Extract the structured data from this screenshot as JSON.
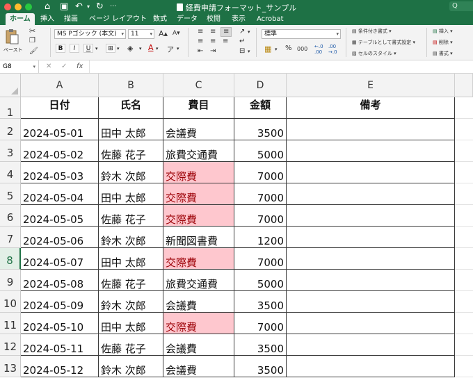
{
  "window": {
    "title": "経費申請フォーマット_サンプル",
    "search_placeholder": "Q"
  },
  "tabs": [
    "ホーム",
    "挿入",
    "描画",
    "ページ レイアウト",
    "数式",
    "データ",
    "校閲",
    "表示",
    "Acrobat"
  ],
  "ribbon": {
    "paste_label": "ペースト",
    "font_name": "MS Pゴシック (本文)",
    "font_size": "11",
    "grow_font": "A",
    "shrink_font": "A",
    "bold": "B",
    "italic": "I",
    "underline": "U",
    "font_color_letter": "A",
    "number_format": "標準",
    "percent": "%",
    "comma": "000",
    "conditional_format": "条件付き書式",
    "format_as_table": "テーブルとして書式設定",
    "cell_styles": "セルのスタイル",
    "insert": "挿入",
    "delete": "削除",
    "format": "書式"
  },
  "formula_bar": {
    "name_box": "G8",
    "fx": "fx",
    "cancel": "✕",
    "enter": "✓"
  },
  "sheet": {
    "columns": [
      "A",
      "B",
      "C",
      "D",
      "E"
    ],
    "rows": [
      "1",
      "2",
      "3",
      "4",
      "5",
      "6",
      "7",
      "8",
      "9",
      "10",
      "11",
      "12",
      "13"
    ],
    "selected_row": "8",
    "headers": [
      "日付",
      "氏名",
      "費目",
      "金額",
      "備考"
    ],
    "data": [
      {
        "date": "2024-05-01",
        "name": "田中 太郎",
        "category": "会議費",
        "amount": "3500",
        "note": "",
        "highlight": false
      },
      {
        "date": "2024-05-02",
        "name": "佐藤 花子",
        "category": "旅費交通費",
        "amount": "5000",
        "note": "",
        "highlight": false
      },
      {
        "date": "2024-05-03",
        "name": "鈴木 次郎",
        "category": "交際費",
        "amount": "7000",
        "note": "",
        "highlight": true
      },
      {
        "date": "2024-05-04",
        "name": "田中 太郎",
        "category": "交際費",
        "amount": "7000",
        "note": "",
        "highlight": true
      },
      {
        "date": "2024-05-05",
        "name": "佐藤 花子",
        "category": "交際費",
        "amount": "7000",
        "note": "",
        "highlight": true
      },
      {
        "date": "2024-05-06",
        "name": "鈴木 次郎",
        "category": "新聞図書費",
        "amount": "1200",
        "note": "",
        "highlight": false
      },
      {
        "date": "2024-05-07",
        "name": "田中 太郎",
        "category": "交際費",
        "amount": "7000",
        "note": "",
        "highlight": true
      },
      {
        "date": "2024-05-08",
        "name": "佐藤 花子",
        "category": "旅費交通費",
        "amount": "5000",
        "note": "",
        "highlight": false
      },
      {
        "date": "2024-05-09",
        "name": "鈴木 次郎",
        "category": "会議費",
        "amount": "3500",
        "note": "",
        "highlight": false
      },
      {
        "date": "2024-05-10",
        "name": "田中 太郎",
        "category": "交際費",
        "amount": "7000",
        "note": "",
        "highlight": true
      },
      {
        "date": "2024-05-11",
        "name": "佐藤 花子",
        "category": "会議費",
        "amount": "3500",
        "note": "",
        "highlight": false
      },
      {
        "date": "2024-05-12",
        "name": "鈴木 次郎",
        "category": "会議費",
        "amount": "3500",
        "note": "",
        "highlight": false
      }
    ]
  },
  "colors": {
    "excel_green": "#1e7145",
    "highlight_fill": "#fec7ce",
    "highlight_text": "#9c0006"
  }
}
